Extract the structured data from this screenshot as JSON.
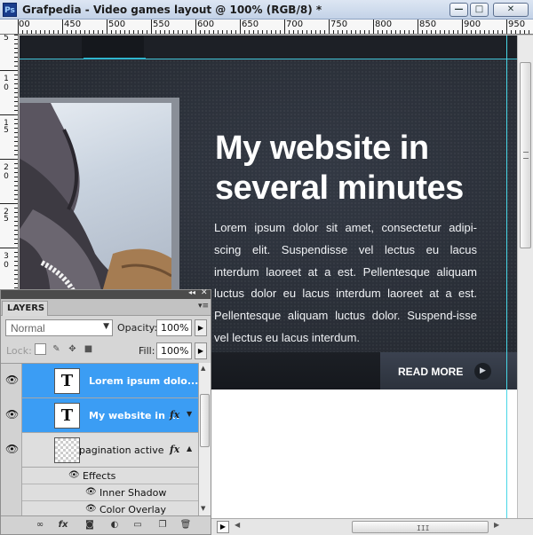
{
  "window": {
    "title": "Grafpedia - Video games layout @ 100% (RGB/8) *",
    "app_icon": "Ps",
    "minimize_glyph": "—",
    "maximize_glyph": "□",
    "close_glyph": "✕"
  },
  "ruler": {
    "top_labels": [
      "00",
      "450",
      "500",
      "550",
      "600",
      "650",
      "700",
      "750",
      "800",
      "850",
      "900",
      "950"
    ],
    "left_labels": [
      "5",
      "1",
      "0",
      "1",
      "5",
      "2",
      "0",
      "2",
      "5",
      "3",
      "0"
    ]
  },
  "site": {
    "hero_title_line1": "My website in",
    "hero_title_line2": "several minutes",
    "hero_body": "Lorem ipsum dolor sit amet, consectetur adipi-scing elit. Suspendisse vel lectus eu lacus interdum laoreet at a est. Pellentesque aliquam luctus dolor eu lacus interdum laoreet at a est. Pellentesque aliquam luctus dolor. Suspend-isse vel lectus eu lacus interdum.",
    "read_more": "READ MORE",
    "read_more_arrow": "▶"
  },
  "layers_panel": {
    "tab": "LAYERS",
    "menu_glyph": "▾≡",
    "collapse_glyph": "◂◂",
    "close_glyph": "✕",
    "blend_mode": "Normal",
    "opacity_label": "Opacity:",
    "opacity_value": "100%",
    "lock_label": "Lock:",
    "fill_label": "Fill:",
    "fill_value": "100%",
    "layers": [
      {
        "name": "Lorem ipsum dolo...",
        "type": "text",
        "selected": true
      },
      {
        "name": "My website in ...",
        "type": "text",
        "selected": true,
        "fx": "fx"
      },
      {
        "name": "pagination active",
        "type": "shape",
        "selected": false,
        "fx": "fx"
      }
    ],
    "effects_label": "Effects",
    "effects": [
      "Inner Shadow",
      "Color Overlay"
    ],
    "footer_icons": [
      "link-icon",
      "fx-icon",
      "mask-icon",
      "adjustment-icon",
      "group-icon",
      "new-layer-icon",
      "trash-icon"
    ]
  },
  "colors": {
    "selection": "#3b9df4",
    "guide": "#47d6e6",
    "hero_bg": "#2a2f37"
  }
}
